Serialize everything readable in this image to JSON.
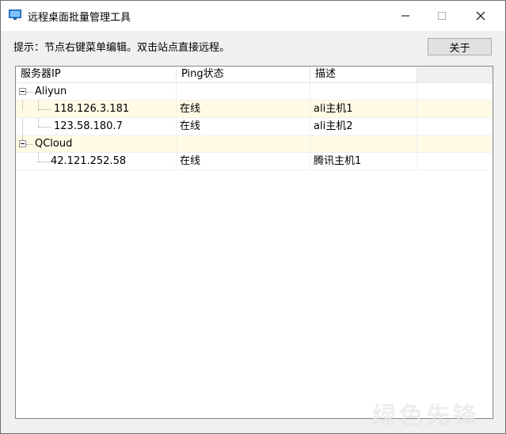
{
  "window": {
    "title": "远程桌面批量管理工具",
    "controls": {
      "minimize": "—",
      "maximize": "☐",
      "close": "✕"
    }
  },
  "hint_text": "提示：节点右键菜单编辑。双击站点直接远程。",
  "about_button": "关于",
  "table": {
    "columns": [
      "服务器IP",
      "Ping状态",
      "描述",
      ""
    ],
    "groups": [
      {
        "name": "Aliyun",
        "servers": [
          {
            "ip": "118.126.3.181",
            "ping": "在线",
            "desc": "ali主机1"
          },
          {
            "ip": "123.58.180.7",
            "ping": "在线",
            "desc": "ali主机2"
          }
        ]
      },
      {
        "name": "QCloud",
        "servers": [
          {
            "ip": "42.121.252.58",
            "ping": "在线",
            "desc": "腾讯主机1"
          }
        ]
      }
    ]
  },
  "watermark_text": "绿色先锋",
  "colors": {
    "row_highlight": "#fffbe4",
    "window_bg": "#f0f0f0",
    "titlebar_bg": "#ffffff"
  }
}
